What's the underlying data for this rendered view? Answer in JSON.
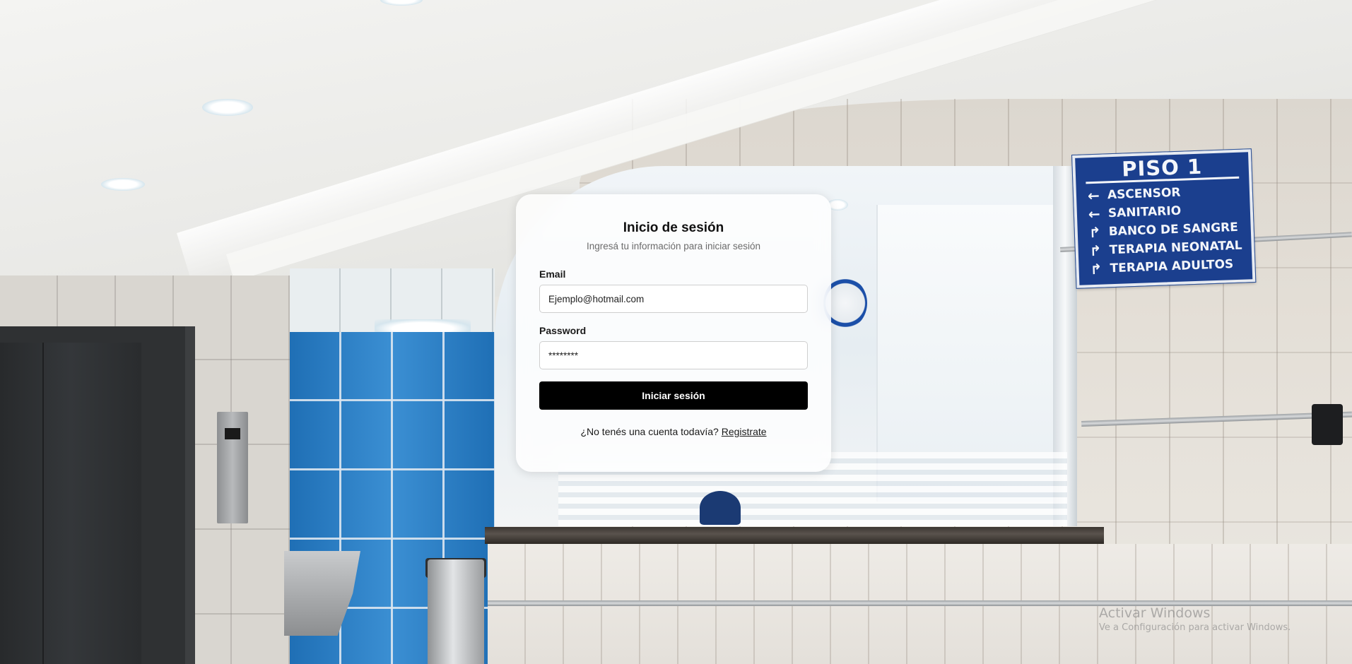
{
  "login": {
    "title": "Inicio de sesión",
    "subtitle": "Ingresá tu información para iniciar sesión",
    "email_label": "Email",
    "email_value": "Ejemplo@hotmail.com",
    "password_label": "Password",
    "password_value": "********",
    "submit_label": "Iniciar sesión",
    "register_prompt": "¿No tenés una cuenta todavía?",
    "register_link": "Registrate"
  },
  "sign": {
    "title": "PISO 1",
    "items": [
      {
        "icon": "arrow-left-icon",
        "label": "ASCENSOR"
      },
      {
        "icon": "arrow-left-icon",
        "label": "SANITARIO"
      },
      {
        "icon": "arrow-up-turn-icon",
        "label": "BANCO DE SANGRE"
      },
      {
        "icon": "arrow-up-turn-icon",
        "label": "TERAPIA NEONATAL"
      },
      {
        "icon": "arrow-up-turn-icon",
        "label": "TERAPIA ADULTOS"
      }
    ]
  },
  "watermark": {
    "title": "Activar Windows",
    "subtitle": "Ve a Configuración para activar Windows."
  },
  "colors": {
    "button_bg": "#000000",
    "button_text": "#ffffff",
    "card_bg": "#ffffff",
    "sign_blue": "#1b3f8e"
  }
}
